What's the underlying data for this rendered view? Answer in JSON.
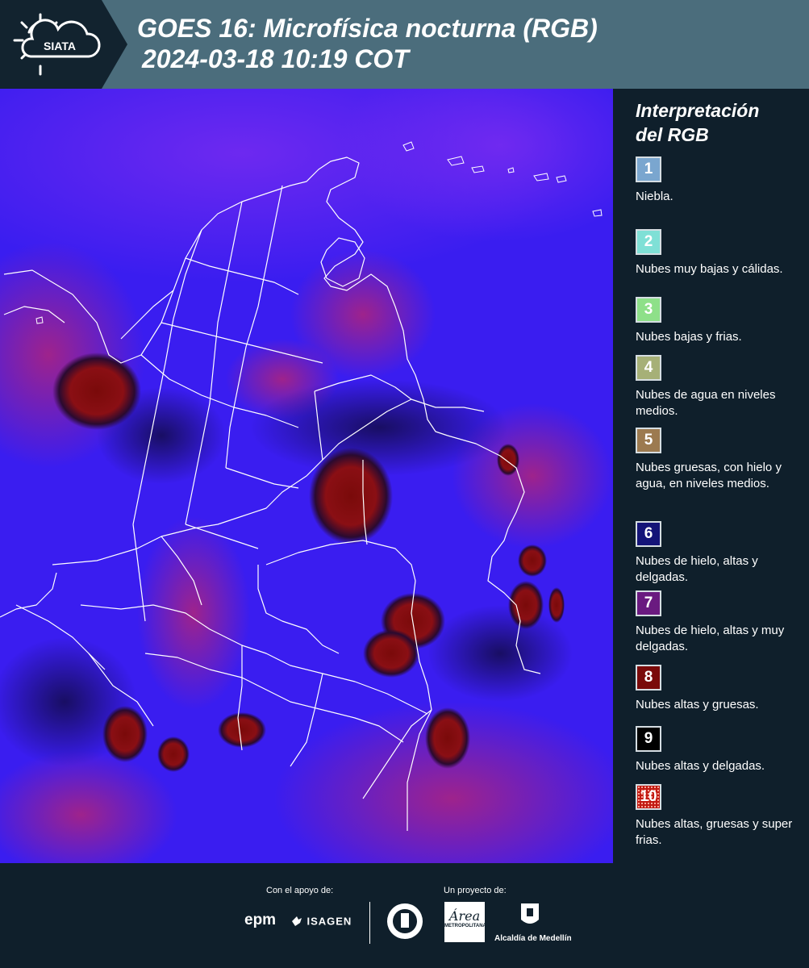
{
  "header": {
    "brand": "SIATA",
    "title_line1": "GOES 16: Microfísica nocturna (RGB)",
    "title_line2": "2024-03-18 10:19 COT",
    "background_color": "#4b6d7c"
  },
  "map": {
    "base_color": "#3a1df0",
    "border_color": "#ffffff",
    "cloud_classes_shown": [
      "Nubes de hielo, altas y muy delgadas",
      "Nubes altas y gruesas",
      "Nubes altas y delgadas"
    ]
  },
  "legend": {
    "title_line1": "Interpretación",
    "title_line2": "del RGB",
    "items": [
      {
        "number": "1",
        "color": "#7aa6cf",
        "label": "Niebla."
      },
      {
        "number": "2",
        "color": "#7fe0d6",
        "label": "Nubes muy bajas y cálidas."
      },
      {
        "number": "3",
        "color": "#8ee089",
        "label": "Nubes bajas y frias."
      },
      {
        "number": "4",
        "color": "#a6b077",
        "label": "Nubes de agua en niveles medios."
      },
      {
        "number": "5",
        "color": "#9c7a50",
        "label": "Nubes gruesas, con hielo y agua, en niveles medios."
      },
      {
        "number": "6",
        "color": "#141478",
        "label": "Nubes de hielo, altas y delgadas."
      },
      {
        "number": "7",
        "color": "#6a1a80",
        "label": "Nubes de hielo, altas y muy delgadas."
      },
      {
        "number": "8",
        "color": "#7a0a0a",
        "label": "Nubes altas y gruesas."
      },
      {
        "number": "9",
        "color": "#000000",
        "label": "Nubes altas y delgadas."
      },
      {
        "number": "10",
        "color": "#c21a12",
        "label": "Nubes altas, gruesas y super frias."
      }
    ]
  },
  "footer": {
    "support_caption": "Con el apoyo de:",
    "project_caption": "Un proyecto de:",
    "support_logos": [
      "epm",
      "ISAGEN"
    ],
    "project_logos": [
      "Universidad de Medellín seal",
      "Área Metropolitana",
      "Alcaldía de Medellín"
    ],
    "metro_text": "Área",
    "metro_sub": "METROPOLITANA",
    "alcaldia_text": "Alcaldía de Medellín"
  }
}
